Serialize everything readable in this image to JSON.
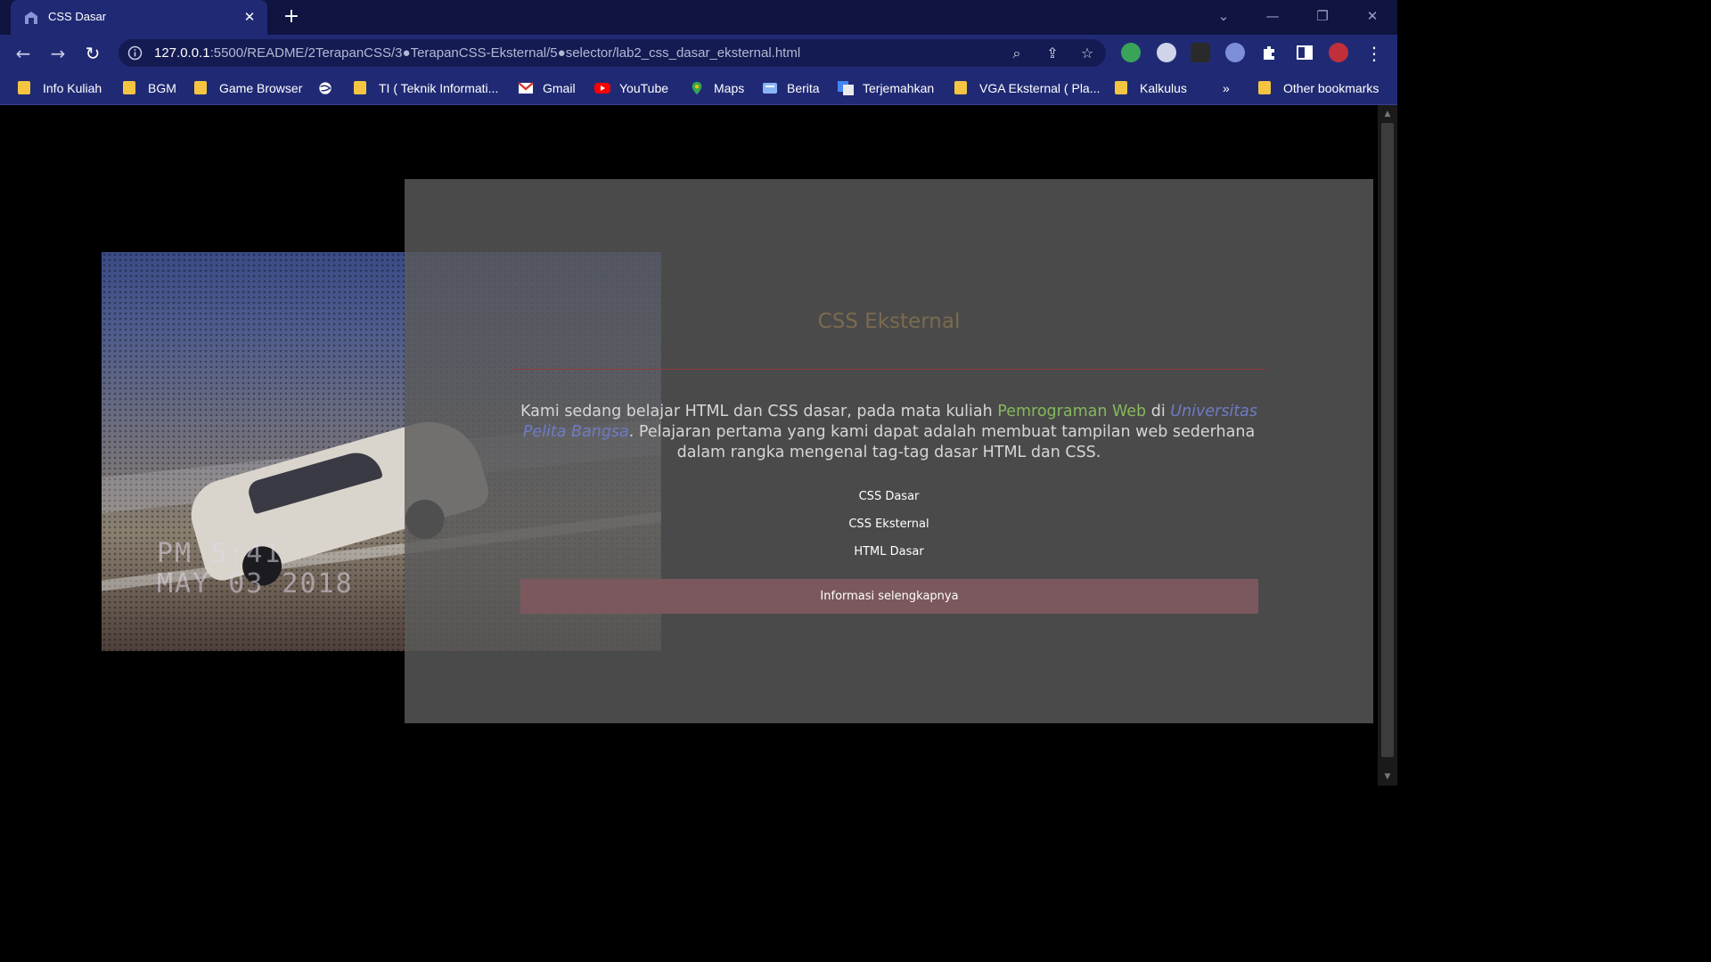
{
  "browser": {
    "tab_title": "CSS Dasar",
    "tab_close": "✕",
    "new_tab": "+",
    "url_host": "127.0.0.1",
    "url_path": ":5500/README/2TerapanCSS/3●TerapanCSS-Eksternal/5●selector/lab2_css_dasar_eksternal.html",
    "window_controls": {
      "dropdown": "⌄",
      "minimize": "—",
      "restore": "❐",
      "close": "✕"
    },
    "nav": {
      "back": "←",
      "forward": "→",
      "reload": "↻"
    },
    "omnibox_icons": {
      "zoom": "⌕",
      "share": "⇪",
      "star": "☆"
    },
    "menu": "⋮",
    "bookmarks": [
      {
        "label": "Info Kuliah",
        "icon": "folder-icon"
      },
      {
        "label": "BGM",
        "icon": "folder-icon"
      },
      {
        "label": "Game Browser",
        "icon": "folder-icon"
      },
      {
        "label": "",
        "icon": "globe-icon"
      },
      {
        "label": "TI ( Teknik Informati...",
        "icon": "folder-icon"
      },
      {
        "label": "Gmail",
        "icon": "gmail-icon"
      },
      {
        "label": "YouTube",
        "icon": "youtube-icon"
      },
      {
        "label": "Maps",
        "icon": "maps-icon"
      },
      {
        "label": "Berita",
        "icon": "news-icon"
      },
      {
        "label": "Terjemahkan",
        "icon": "translate-icon"
      },
      {
        "label": "VGA Eksternal ( Pla...",
        "icon": "folder-icon"
      },
      {
        "label": "Kalkulus",
        "icon": "folder-icon"
      }
    ],
    "bookmarks_overflow": "»",
    "other_bookmarks": "Other bookmarks",
    "colors": {
      "tabstrip": "#0f1440",
      "toolbar": "#202a74",
      "folder": "#f5c542"
    }
  },
  "page": {
    "photo_stamp_line1": "PM 5:41",
    "photo_stamp_line2": "MAY 03 2018",
    "heading": "CSS Eksternal",
    "para_part1": "Kami sedang belajar HTML dan CSS dasar, pada mata kuliah ",
    "para_highlight1": "Pemrograman Web",
    "para_part2": " di ",
    "para_highlight2": "Universitas Pelita Bangsa",
    "para_part3": ". Pelajaran pertama yang kami dapat adalah membuat tampilan web sederhana dalam rangka mengenal tag-tag dasar HTML dan CSS.",
    "links": [
      "CSS Dasar",
      "CSS Eksternal",
      "HTML Dasar"
    ],
    "more_button": "Informasi selengkapnya",
    "colors": {
      "card": "#5a5a5a",
      "heading": "#7a6b4e",
      "button": "#7b585d",
      "highlight_green": "#86b85c",
      "highlight_blue": "#6f7bc6"
    }
  }
}
